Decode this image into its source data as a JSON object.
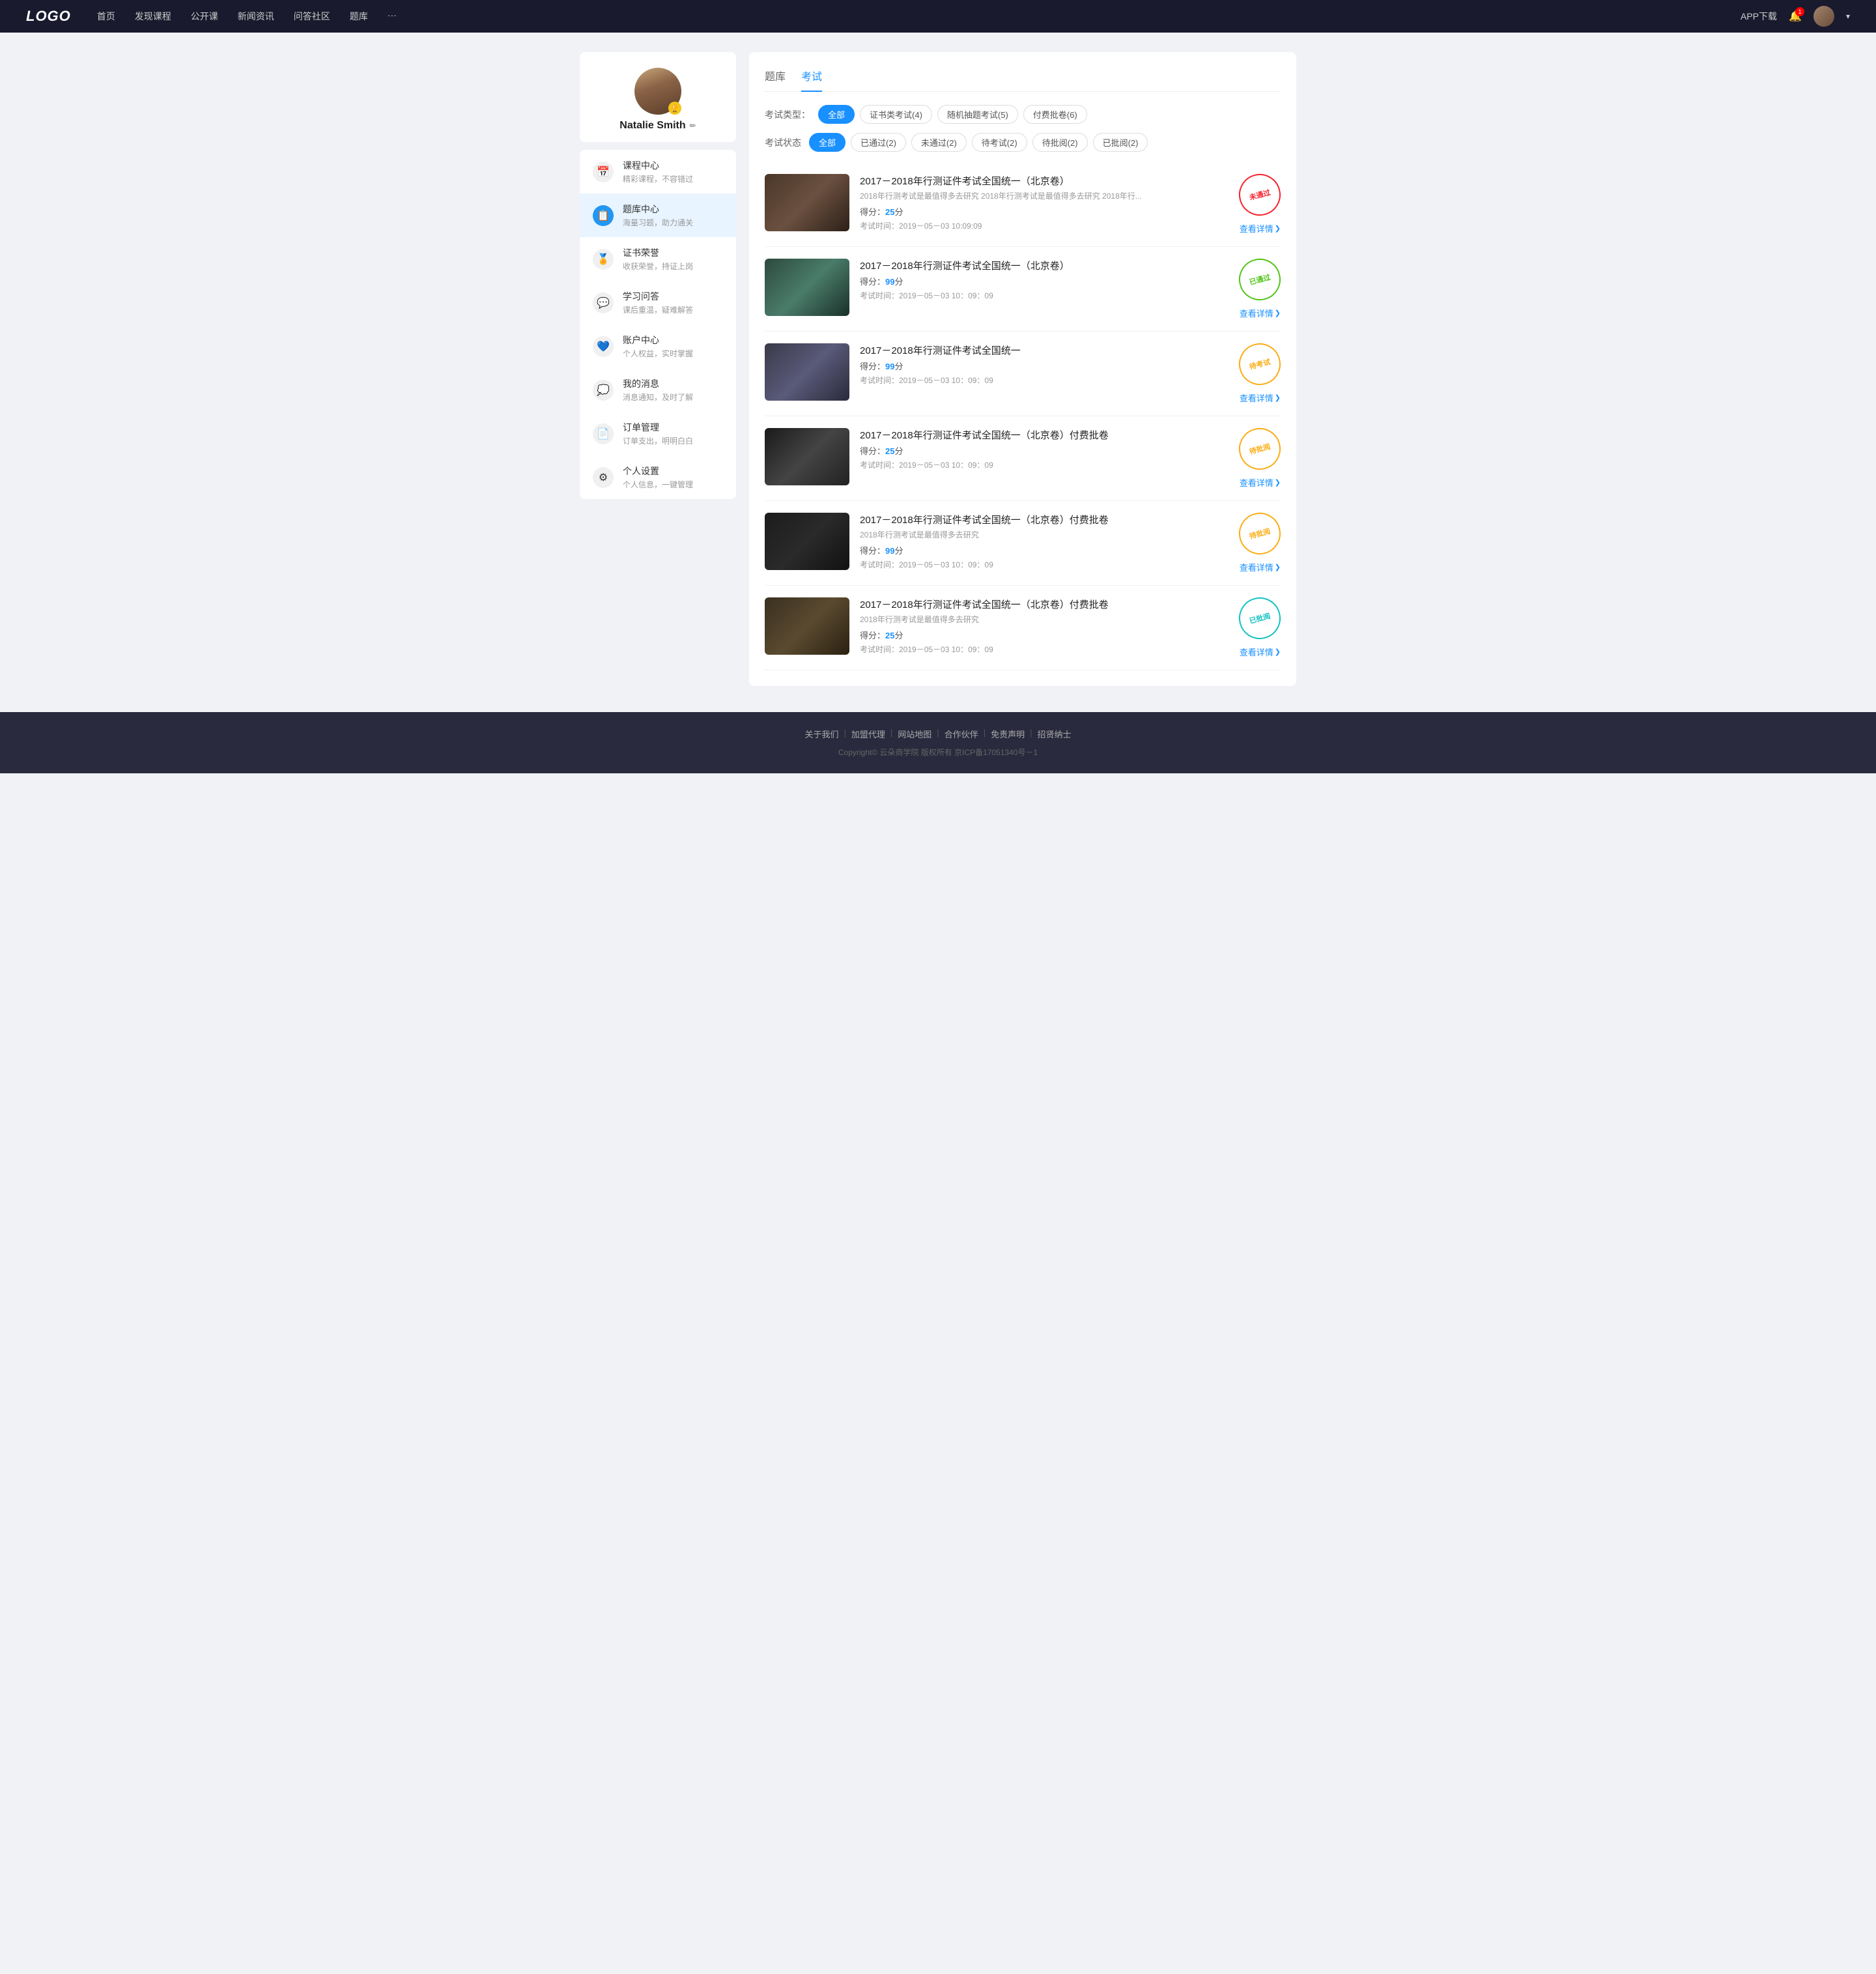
{
  "navbar": {
    "logo": "LOGO",
    "links": [
      "首页",
      "发现课程",
      "公开课",
      "新闻资讯",
      "问答社区",
      "题库",
      "···"
    ],
    "app_download": "APP下载",
    "more_icon": "···"
  },
  "sidebar": {
    "profile": {
      "name": "Natalie Smith",
      "badge": "🏆",
      "edit_icon": "✏"
    },
    "menu_items": [
      {
        "icon": "📅",
        "title": "课程中心",
        "subtitle": "精彩课程，不容错过",
        "active": false
      },
      {
        "icon": "📋",
        "title": "题库中心",
        "subtitle": "海量习题，助力通关",
        "active": true
      },
      {
        "icon": "🏅",
        "title": "证书荣誉",
        "subtitle": "收获荣誉，持证上岗",
        "active": false
      },
      {
        "icon": "💬",
        "title": "学习问答",
        "subtitle": "课后重温，疑难解答",
        "active": false
      },
      {
        "icon": "💙",
        "title": "账户中心",
        "subtitle": "个人权益，实时掌握",
        "active": false
      },
      {
        "icon": "💭",
        "title": "我的消息",
        "subtitle": "消息通知，及时了解",
        "active": false
      },
      {
        "icon": "📄",
        "title": "订单管理",
        "subtitle": "订单支出，明明白白",
        "active": false
      },
      {
        "icon": "⚙",
        "title": "个人设置",
        "subtitle": "个人信息，一键管理",
        "active": false
      }
    ]
  },
  "content": {
    "tabs": [
      {
        "label": "题库",
        "active": false
      },
      {
        "label": "考试",
        "active": true
      }
    ],
    "filter_type": {
      "label": "考试类型：",
      "options": [
        {
          "label": "全部",
          "active": true
        },
        {
          "label": "证书类考试(4)",
          "active": false
        },
        {
          "label": "随机抽题考试(5)",
          "active": false
        },
        {
          "label": "付费批卷(6)",
          "active": false
        }
      ]
    },
    "filter_status": {
      "label": "考试状态",
      "options": [
        {
          "label": "全部",
          "active": true
        },
        {
          "label": "已通过(2)",
          "active": false
        },
        {
          "label": "未通过(2)",
          "active": false
        },
        {
          "label": "待考试(2)",
          "active": false
        },
        {
          "label": "待批阅(2)",
          "active": false
        },
        {
          "label": "已批阅(2)",
          "active": false
        }
      ]
    },
    "exams": [
      {
        "id": 1,
        "title": "2017－2018年行测证件考试全国统一（北京卷）",
        "desc": "2018年行测考试是最值得多去研究 2018年行测考试是最值得多去研究 2018年行...",
        "score": "25",
        "time": "2019－05－03  10:09:09",
        "status": "未通过",
        "stamp_type": "red",
        "thumb_class": "thumb-1"
      },
      {
        "id": 2,
        "title": "2017－2018年行测证件考试全国统一（北京卷）",
        "desc": "",
        "score": "99",
        "time": "2019－05－03  10：09：09",
        "status": "已通过",
        "stamp_type": "green",
        "thumb_class": "thumb-2"
      },
      {
        "id": 3,
        "title": "2017－2018年行测证件考试全国统一",
        "desc": "",
        "score": "99",
        "time": "2019－05－03  10：09：09",
        "status": "待考试",
        "stamp_type": "orange",
        "thumb_class": "thumb-3"
      },
      {
        "id": 4,
        "title": "2017－2018年行测证件考试全国统一（北京卷）付费批卷",
        "desc": "",
        "score": "25",
        "time": "2019－05－03  10：09：09",
        "status": "待批阅",
        "stamp_type": "orange",
        "thumb_class": "thumb-4"
      },
      {
        "id": 5,
        "title": "2017－2018年行测证件考试全国统一（北京卷）付费批卷",
        "desc": "2018年行测考试是最值得多去研究",
        "score": "99",
        "time": "2019－05－03  10：09：09",
        "status": "待批阅",
        "stamp_type": "orange",
        "thumb_class": "thumb-5"
      },
      {
        "id": 6,
        "title": "2017－2018年行测证件考试全国统一（北京卷）付费批卷",
        "desc": "2018年行测考试是最值得多去研究",
        "score": "25",
        "time": "2019－05－03  10：09：09",
        "status": "已批阅",
        "stamp_type": "teal",
        "thumb_class": "thumb-6"
      }
    ],
    "detail_link": "查看详情"
  },
  "footer": {
    "links": [
      "关于我们",
      "加盟代理",
      "网站地图",
      "合作伙伴",
      "免责声明",
      "招贤纳士"
    ],
    "copyright": "Copyright© 云朵商学院  版权所有    京ICP备17051340号－1"
  }
}
